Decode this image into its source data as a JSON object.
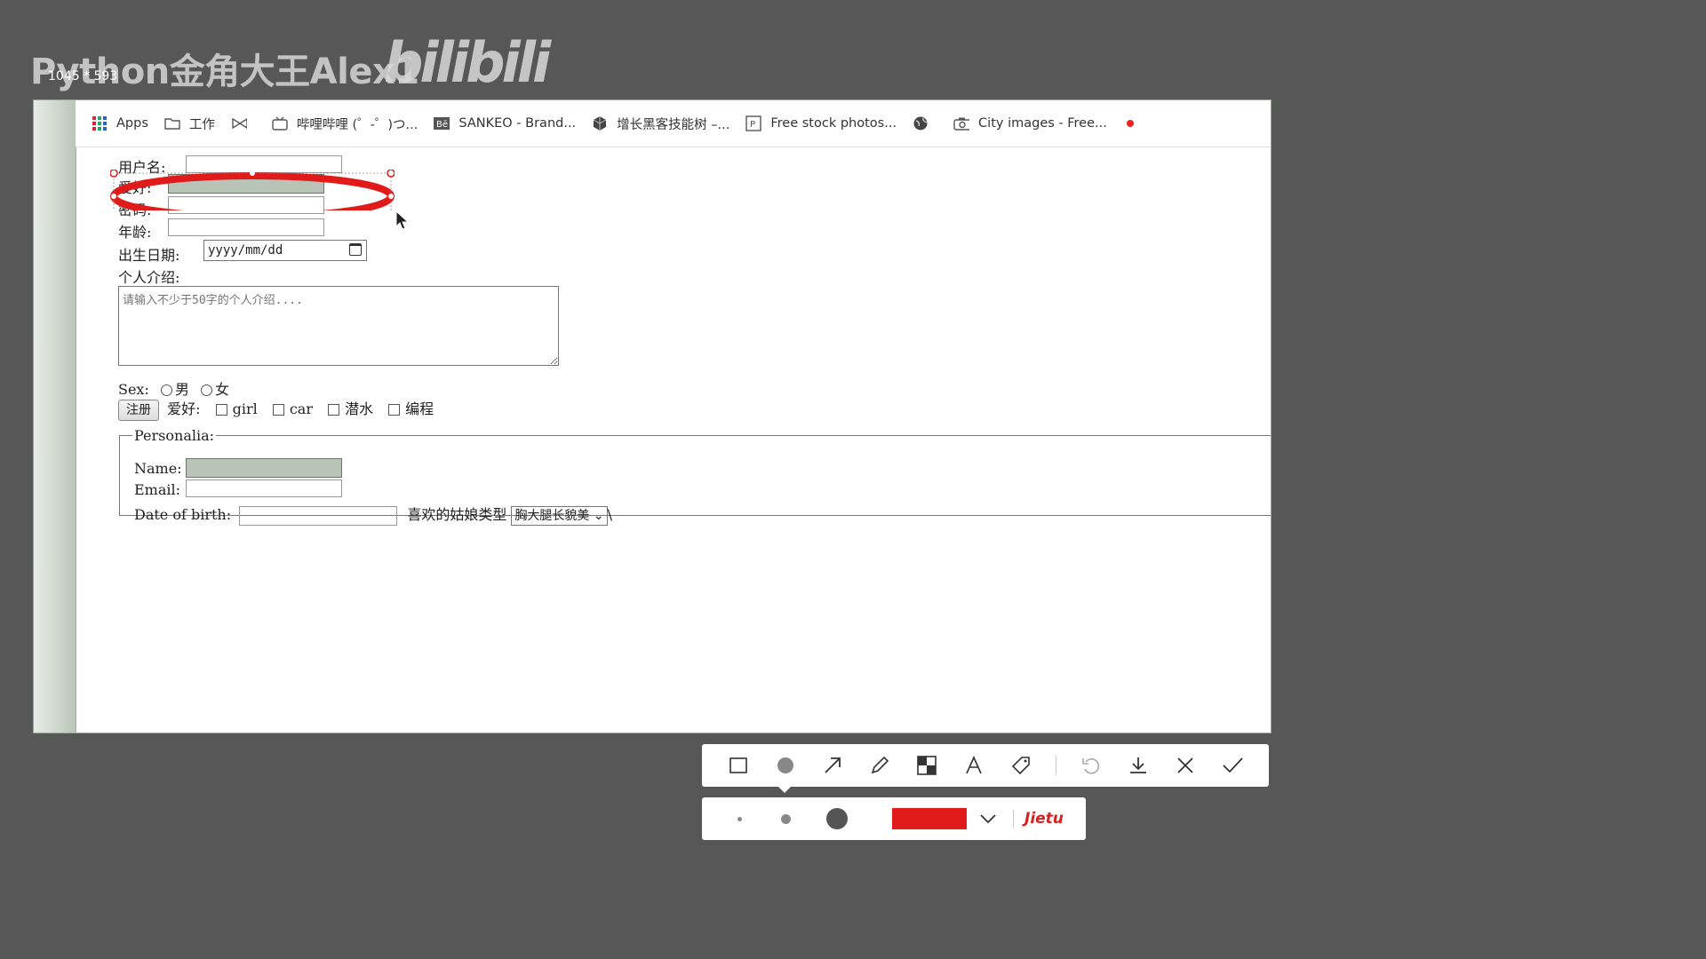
{
  "watermark": {
    "channel": "Python金角大王Alex1",
    "logo": "bilibili",
    "size_readout": "1045 * 593"
  },
  "bookmarks": [
    {
      "label": "Apps",
      "icon": "apps-grid-icon"
    },
    {
      "label": "工作",
      "icon": "folder-icon"
    },
    {
      "label": "",
      "icon": "bowtie-icon"
    },
    {
      "label": "哔哩哔哩 (゜-゜)つ...",
      "icon": "bilibili-tv-icon"
    },
    {
      "label": "SANKEO - Brand...",
      "icon": "behance-icon"
    },
    {
      "label": "增长黑客技能树 –...",
      "icon": "cube-icon"
    },
    {
      "label": "Free stock photos...",
      "icon": "pexels-icon"
    },
    {
      "label": "",
      "icon": "globe-icon"
    },
    {
      "label": "City images - Free...",
      "icon": "camera-icon"
    }
  ],
  "form": {
    "username_label": "用户名:",
    "hobby_label": "爱好:",
    "password_label": "密码:",
    "age_label": "年龄:",
    "birthday_label": "出生日期:",
    "birthday_placeholder": "yyyy/mm/dd",
    "intro_label": "个人介绍:",
    "intro_placeholder": "请输入不少于50字的个人介绍....",
    "sex_label": "Sex:",
    "sex_options": [
      "男",
      "女"
    ],
    "register_button": "注册",
    "hobbies_label": "爱好:",
    "hobbies": [
      "girl",
      "car",
      "潜水",
      "编程"
    ],
    "fieldset": {
      "legend": "Personalia:",
      "name_label": "Name:",
      "email_label": "Email:",
      "dob_label": "Date of birth:",
      "girl_type_label": "喜欢的姑娘类型",
      "girl_type_selected": "胸大腿长貌美",
      "trailing": "\\"
    }
  },
  "annotation_toolbar": {
    "tools": [
      "rectangle-icon",
      "ellipse-icon",
      "arrow-icon",
      "pencil-icon",
      "mosaic-icon",
      "text-icon",
      "tag-icon",
      "undo-icon",
      "download-icon",
      "close-icon",
      "check-icon"
    ],
    "brand": "Jietu",
    "color": "#e11a1a"
  }
}
